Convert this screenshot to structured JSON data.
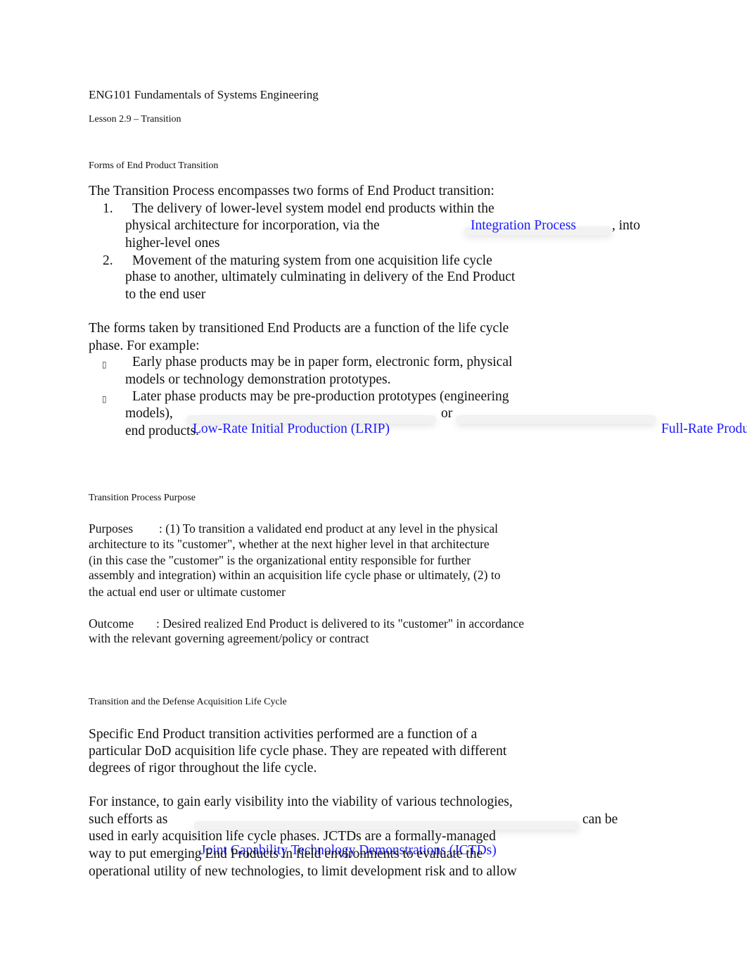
{
  "document": {
    "course_title": "ENG101 Fundamentals of Systems Engineering",
    "lesson": "Lesson 2.9 – Transition",
    "sections": [
      {
        "heading": "Forms of End Product Transition",
        "intro": "The Transition Process encompasses two forms of End Product transition:",
        "numbered_items": [
          {
            "number": "1.",
            "line1": "The delivery of lower-level system model end products within the",
            "line2_before": "physical architecture for incorporation, via the",
            "link": "Integration Process",
            "line2_after": ", into",
            "line3": "higher-level ones"
          },
          {
            "number": "2.",
            "line1": "Movement of the maturing system from one acquisition life cycle",
            "line2": "phase to another, ultimately culminating in delivery of the End Product",
            "line3": "to the end user"
          }
        ],
        "forms_intro_line1": "The forms taken by transitioned End Products are a function of the life cycle",
        "forms_intro_line2": "phase. For example:",
        "bullets": [
          {
            "glyph": "▯",
            "line1": "Early phase products may be in paper form, electronic form, physical",
            "line2": "models or technology demonstration prototypes."
          },
          {
            "glyph": "▯",
            "line1": "Later phase products may be pre-production prototypes (engineering",
            "line2_before": "models),",
            "link1": "Low-Rate Initial Production (LRIP)",
            "connector": "or",
            "link2": "Full-Rate Production (FRP)",
            "line3": "end products."
          }
        ]
      },
      {
        "heading": "Transition Process Purpose",
        "purposes_label": "Purposes",
        "purposes_lines": [
          ": (1) To transition a validated end product at any level in the physical",
          "architecture to its \"customer\", whether at the next higher level in that architecture",
          "(in this case the \"customer\" is the organizational entity responsible for further",
          "assembly and integration) within an acquisition life cycle phase or ultimately, (2) to",
          "the actual end user or ultimate customer"
        ],
        "outcome_label": "Outcome",
        "outcome_lines": [
          ": Desired realized End Product is delivered to its \"customer\" in accordance",
          "with the relevant governing agreement/policy or contract"
        ]
      },
      {
        "heading": "Transition and the Defense Acquisition Life Cycle",
        "para1": [
          "Specific End Product transition activities performed are a function of a",
          "particular DoD acquisition life cycle phase. They are repeated with different",
          "degrees of rigor throughout the life cycle."
        ],
        "para2_line1": "For instance, to gain early visibility into the viability of various technologies,",
        "para2_line2_before": "such efforts as",
        "para2_link": "Joint Capability Technology Demonstrations (JCTDs)",
        "para2_line2_after": "can be",
        "para2_rest": [
          "used in early acquisition life cycle phases. JCTDs are a formally-managed",
          "way to put emerging End Products in field environments to evaluate the",
          "operational utility of new technologies, to limit development risk and to allow"
        ]
      }
    ]
  }
}
